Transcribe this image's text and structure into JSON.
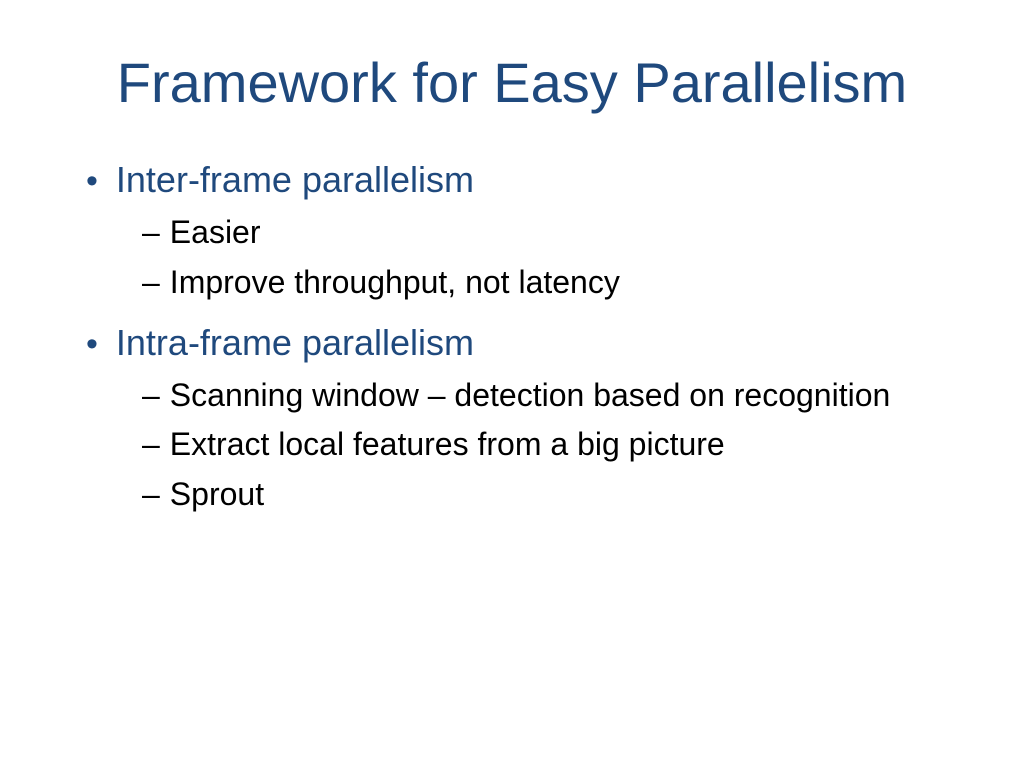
{
  "title": "Framework for Easy Parallelism",
  "bullets": [
    {
      "text": "Inter-frame parallelism",
      "sub": [
        "Easier",
        "Improve throughput, not latency"
      ]
    },
    {
      "text": "Intra-frame parallelism",
      "sub": [
        "Scanning window – detection based on recognition",
        "Extract local features from a big picture",
        "Sprout"
      ]
    }
  ]
}
